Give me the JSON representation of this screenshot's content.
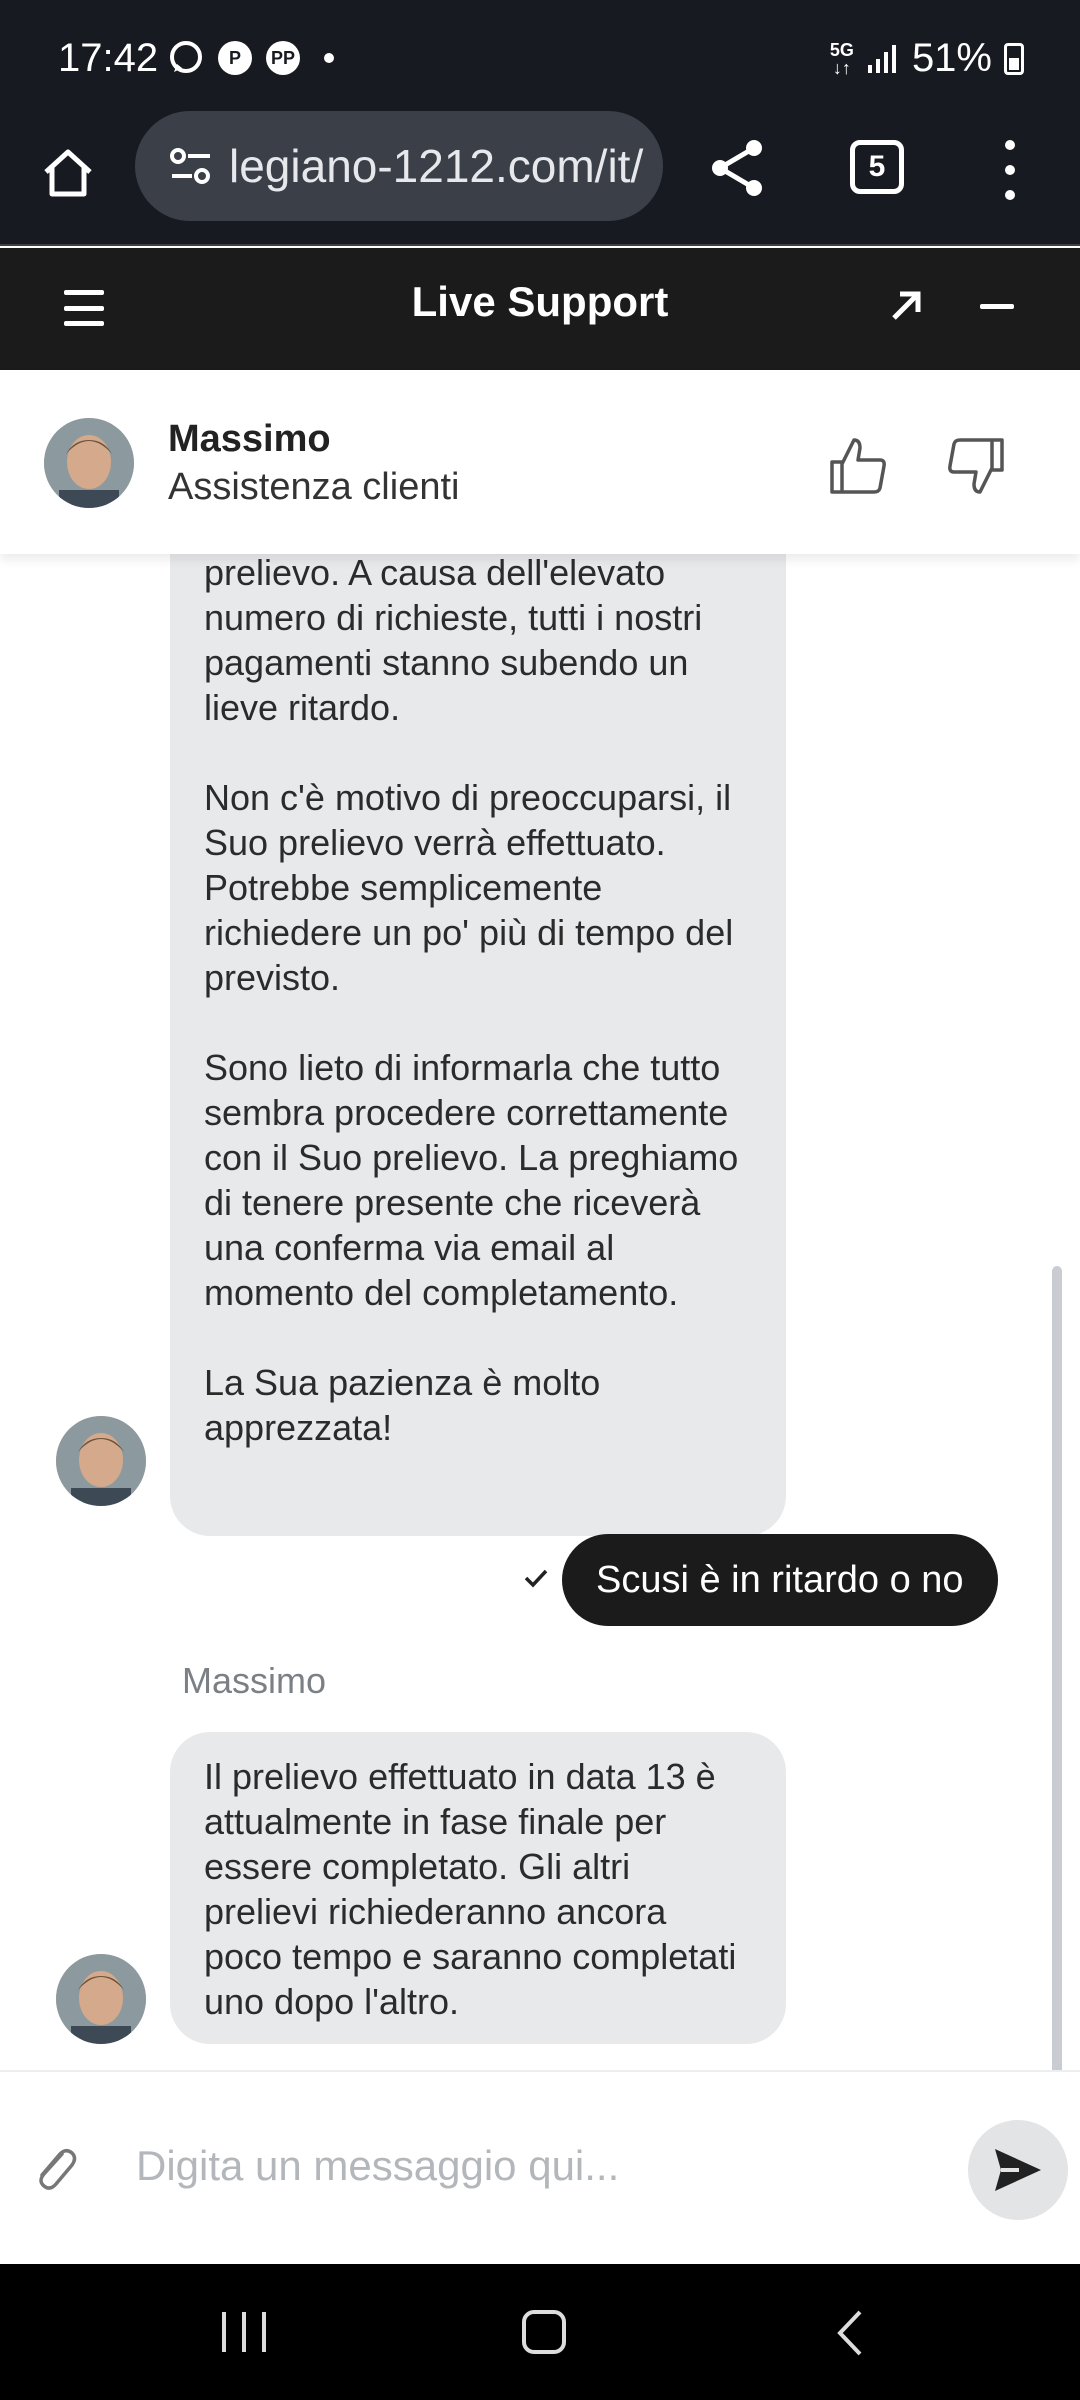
{
  "status_bar": {
    "time": "17:42",
    "left_icons": [
      "whatsapp-icon",
      "pinterest-icon",
      "paypal-icon",
      "dot-icon"
    ],
    "network_top": "5G",
    "network_bottom": "↓↑",
    "battery": "51%"
  },
  "browser": {
    "url": "legiano-1212.com/it/",
    "tab_count": "5"
  },
  "support_header": {
    "title": "Live Support"
  },
  "agent": {
    "name": "Massimo",
    "role": "Assistenza clienti"
  },
  "messages": [
    {
      "sender": "agent",
      "paragraphs": [
        "prelievo. A causa dell'elevato numero di richieste, tutti i nostri pagamenti stanno subendo un lieve ritardo.",
        "Non c'è motivo di preoccuparsi, il Suo prelievo verrà effettuato. Potrebbe semplicemente richiedere un po' più di tempo del previsto.",
        "Sono lieto di informarla che tutto sembra procedere correttamente con il Suo prelievo. La preghiamo di tenere presente che riceverà una conferma via email al momento del completamento.",
        "La Sua pazienza è molto apprezzata!"
      ]
    },
    {
      "sender": "user",
      "text": "Scusi è in ritardo o no"
    },
    {
      "sender": "agent",
      "sender_label": "Massimo",
      "text": "Il prelievo effettuato in data 13 è attualmente in fase finale per essere completato. Gli altri prelievi richiederanno ancora poco tempo e saranno completati uno dopo l'altro."
    }
  ],
  "input": {
    "placeholder": "Digita un messaggio qui..."
  },
  "colors": {
    "dark_bar": "#171a20",
    "agent_bubble": "#e8e9eb",
    "user_bubble": "#1b1b1c"
  }
}
